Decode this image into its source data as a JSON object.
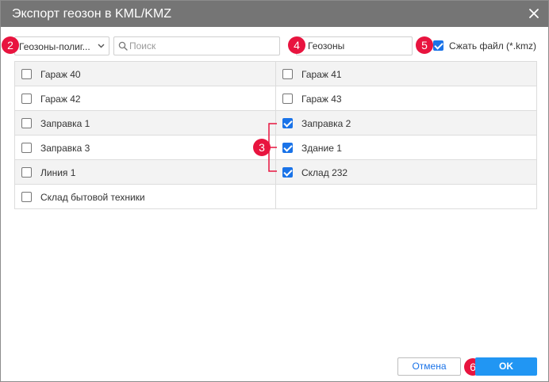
{
  "dialog": {
    "title": "Экспорт геозон в KML/KMZ",
    "close_icon": "close-icon"
  },
  "toolbar": {
    "type_select_value": "Геозоны-полиг...",
    "search_placeholder": "Поиск",
    "name_value": "Геозоны",
    "compress_label": "Сжать файл (*.kmz)",
    "compress_checked": true
  },
  "geofences": [
    {
      "label": "Гараж 40",
      "checked": false
    },
    {
      "label": "Гараж 41",
      "checked": false
    },
    {
      "label": "Гараж 42",
      "checked": false
    },
    {
      "label": "Гараж 43",
      "checked": false
    },
    {
      "label": "Заправка 1",
      "checked": false
    },
    {
      "label": "Заправка 2",
      "checked": true
    },
    {
      "label": "Заправка 3",
      "checked": false
    },
    {
      "label": "Здание 1",
      "checked": true
    },
    {
      "label": "Линия 1",
      "checked": false
    },
    {
      "label": "Склад 232",
      "checked": true
    },
    {
      "label": "Склад бытовой техники",
      "checked": false
    }
  ],
  "markers": {
    "m2": "2",
    "m3": "3",
    "m4": "4",
    "m5": "5",
    "m6": "6"
  },
  "footer": {
    "cancel_label": "Отмена",
    "ok_label": "OK"
  },
  "colors": {
    "titlebar": "#757575",
    "accent": "#2196f3",
    "marker": "#e8143f",
    "checkbox_checked": "#1a73e8"
  }
}
